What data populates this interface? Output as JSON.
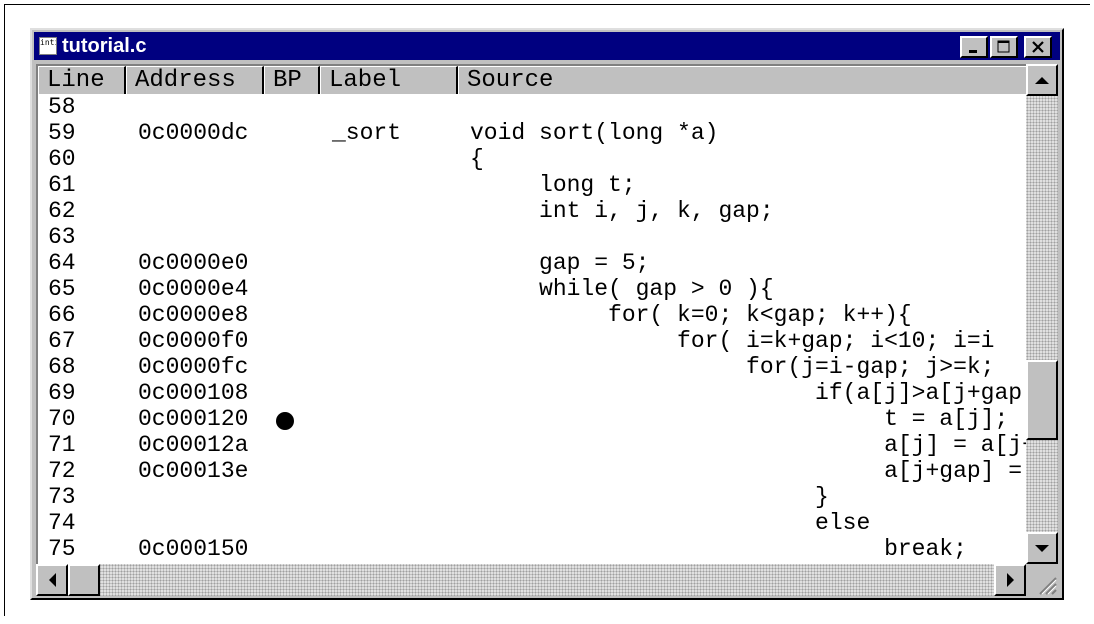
{
  "window": {
    "title": "tutorial.c",
    "icon_name": "source-file-icon",
    "icon_text": "inti;",
    "title_bar_color": "#000080"
  },
  "columns": [
    "Line",
    "Address",
    "BP",
    "Label",
    "Source"
  ],
  "rows": [
    {
      "line": "58",
      "address": "",
      "bp": false,
      "label": "",
      "source": ""
    },
    {
      "line": "59",
      "address": "0c0000dc",
      "bp": false,
      "label": "_sort",
      "source": "void sort(long *a)"
    },
    {
      "line": "60",
      "address": "",
      "bp": false,
      "label": "",
      "source": "{"
    },
    {
      "line": "61",
      "address": "",
      "bp": false,
      "label": "",
      "source": "     long t;"
    },
    {
      "line": "62",
      "address": "",
      "bp": false,
      "label": "",
      "source": "     int i, j, k, gap;"
    },
    {
      "line": "63",
      "address": "",
      "bp": false,
      "label": "",
      "source": ""
    },
    {
      "line": "64",
      "address": "0c0000e0",
      "bp": false,
      "label": "",
      "source": "     gap = 5;"
    },
    {
      "line": "65",
      "address": "0c0000e4",
      "bp": false,
      "label": "",
      "source": "     while( gap > 0 ){"
    },
    {
      "line": "66",
      "address": "0c0000e8",
      "bp": false,
      "label": "",
      "source": "          for( k=0; k<gap; k++){"
    },
    {
      "line": "67",
      "address": "0c0000f0",
      "bp": false,
      "label": "",
      "source": "               for( i=k+gap; i<10; i=i"
    },
    {
      "line": "68",
      "address": "0c0000fc",
      "bp": false,
      "label": "",
      "source": "                    for(j=i-gap; j>=k;"
    },
    {
      "line": "69",
      "address": "0c000108",
      "bp": false,
      "label": "",
      "source": "                         if(a[j]>a[j+gap"
    },
    {
      "line": "70",
      "address": "0c000120",
      "bp": true,
      "label": "",
      "source": "                              t = a[j];"
    },
    {
      "line": "71",
      "address": "0c00012a",
      "bp": false,
      "label": "",
      "source": "                              a[j] = a[j+"
    },
    {
      "line": "72",
      "address": "0c00013e",
      "bp": false,
      "label": "",
      "source": "                              a[j+gap] ="
    },
    {
      "line": "73",
      "address": "",
      "bp": false,
      "label": "",
      "source": "                         }"
    },
    {
      "line": "74",
      "address": "",
      "bp": false,
      "label": "",
      "source": "                         else"
    },
    {
      "line": "75",
      "address": "0c000150",
      "bp": false,
      "label": "",
      "source": "                              break;"
    }
  ]
}
